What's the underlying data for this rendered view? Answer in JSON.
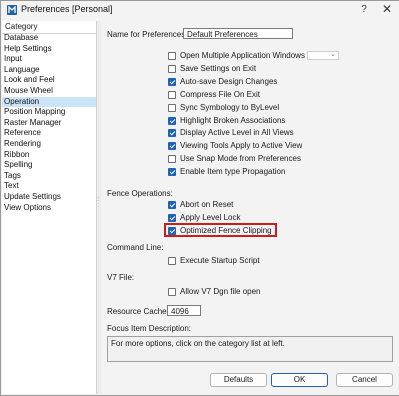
{
  "window": {
    "title": "Preferences [Personal]",
    "help_glyph": "?",
    "close_glyph": "✕"
  },
  "category": {
    "header": "Category",
    "items": [
      "Database",
      "Help Settings",
      "Input",
      "Language",
      "Look and Feel",
      "Mouse Wheel",
      "Operation",
      "Position Mapping",
      "Raster Manager",
      "Reference",
      "Rendering",
      "Ribbon",
      "Spelling",
      "Tags",
      "Text",
      "Update Settings",
      "View Options"
    ],
    "selected": "Operation"
  },
  "name_for_preferences": {
    "label": "Name for Preferences:",
    "value": "Default Preferences"
  },
  "options": [
    {
      "label": "Open Multiple Application Windows",
      "checked": false
    },
    {
      "label": "Save Settings on Exit",
      "checked": false
    },
    {
      "label": "Auto-save Design Changes",
      "checked": true
    },
    {
      "label": "Compress File On Exit",
      "checked": false
    },
    {
      "label": "Sync Symbology to ByLevel",
      "checked": false
    },
    {
      "label": "Highlight Broken Associations",
      "checked": true
    },
    {
      "label": "Display Active Level in All Views",
      "checked": true
    },
    {
      "label": "Viewing Tools Apply to Active View",
      "checked": true
    },
    {
      "label": "Use Snap Mode from Preferences",
      "checked": false
    },
    {
      "label": "Enable Item type Propagation",
      "checked": true
    }
  ],
  "fence": {
    "label": "Fence Operations:",
    "options": [
      {
        "label": "Abort on Reset",
        "checked": true
      },
      {
        "label": "Apply Level Lock",
        "checked": true
      },
      {
        "label": "Optimized Fence Clipping",
        "checked": true
      }
    ]
  },
  "command_line": {
    "label": "Command Line:",
    "option": {
      "label": "Execute Startup Script",
      "checked": false
    }
  },
  "v7_file": {
    "label": "V7 File:",
    "option": {
      "label": "Allow V7 Dgn file open",
      "checked": false
    }
  },
  "resource_cache": {
    "label": "Resource Cache:",
    "value": "4096"
  },
  "focus": {
    "label": "Focus Item Description:",
    "text": "For more options, click on the category list at left."
  },
  "buttons": {
    "defaults": "Defaults",
    "ok": "OK",
    "cancel": "Cancel"
  },
  "colors": {
    "accent": "#1e63b5",
    "selection": "#cce4f7",
    "highlight_box": "#d11a1a"
  },
  "icons": {
    "app": "microstation-icon",
    "help": "question-icon",
    "close": "close-icon"
  }
}
